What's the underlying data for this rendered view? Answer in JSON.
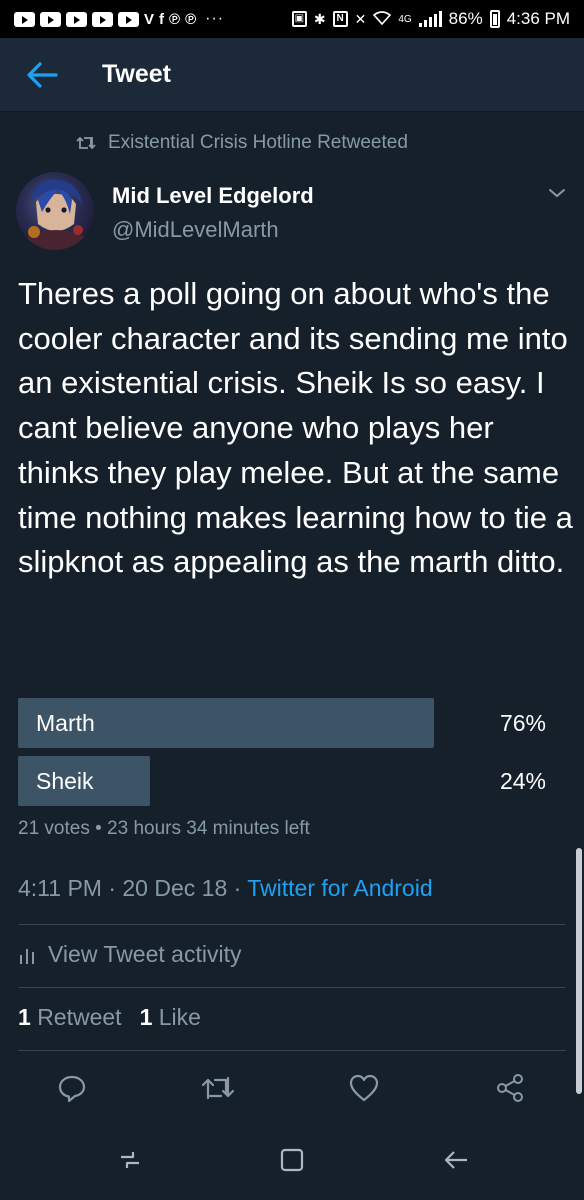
{
  "status_bar": {
    "notification_icons": [
      "youtube-icon",
      "youtube-icon",
      "youtube-icon",
      "youtube-icon",
      "youtube-icon",
      "v-app-icon",
      "facebook-icon",
      "pinterest-icon",
      "pinterest-icon"
    ],
    "more": "···",
    "network": "4G",
    "battery": "86%",
    "time": "4:36 PM"
  },
  "header": {
    "title": "Tweet"
  },
  "tweet": {
    "retweeted_by": "Existential Crisis Hotline Retweeted",
    "author_name": "Mid Level Edgelord",
    "author_handle": "@MidLevelMarth",
    "text": "Theres a poll going on about who's the cooler character and its sending me into an existential crisis. Sheik Is so easy. I cant believe anyone who plays her thinks they play melee. But at the same time nothing makes learning how to tie a slipknot as appealing as the marth ditto.",
    "poll": {
      "options": [
        {
          "label": "Marth",
          "percent_text": "76%",
          "percent": 76
        },
        {
          "label": "Sheik",
          "percent_text": "24%",
          "percent": 24
        }
      ],
      "meta": "21 votes • 23 hours 34 minutes left"
    },
    "timestamp": "4:11 PM · 20 Dec 18 · ",
    "source": "Twitter for Android",
    "activity_label": "View Tweet activity",
    "retweet_count": "1",
    "retweet_label": "Retweet",
    "like_count": "1",
    "like_label": "Like"
  },
  "colors": {
    "background": "#15202b",
    "header": "#1c2938",
    "accent": "#1da1f2",
    "secondary_text": "#8899a6",
    "poll_bar": "#3d5466",
    "divider": "#38444d"
  }
}
